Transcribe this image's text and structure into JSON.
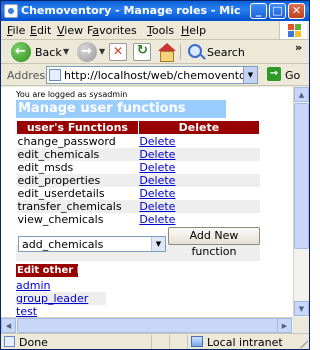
{
  "window": {
    "title": "Chemoventory - Manage roles - Microsoft Internet Ex...",
    "minimize": "_",
    "maximize": "□",
    "close": "✕"
  },
  "menu": {
    "items": [
      {
        "pre": "",
        "key": "F",
        "post": "ile"
      },
      {
        "pre": "",
        "key": "E",
        "post": "dit"
      },
      {
        "pre": "",
        "key": "V",
        "post": "iew"
      },
      {
        "pre": "F",
        "key": "a",
        "post": "vorites"
      },
      {
        "pre": "",
        "key": "T",
        "post": "ools"
      },
      {
        "pre": "",
        "key": "H",
        "post": "elp"
      }
    ]
  },
  "toolbar": {
    "back": "Back",
    "search": "Search",
    "overflow": "»"
  },
  "address": {
    "label": "Address",
    "url": "http://localhost/web/chemoventory/manage_fun",
    "go": "Go"
  },
  "page": {
    "logged_in": "You are logged as sysadmin",
    "title": "Manage user functions",
    "table": {
      "col_functions": "user's Functions",
      "col_delete": "Delete",
      "rows": [
        {
          "name": "change_password",
          "action": "Delete"
        },
        {
          "name": "edit_chemicals",
          "action": "Delete"
        },
        {
          "name": "edit_msds",
          "action": "Delete"
        },
        {
          "name": "edit_properties",
          "action": "Delete"
        },
        {
          "name": "edit_userdetails",
          "action": "Delete"
        },
        {
          "name": "transfer_chemicals",
          "action": "Delete"
        },
        {
          "name": "view_chemicals",
          "action": "Delete"
        }
      ]
    },
    "select_value": "add_chemicals",
    "add_button": "Add New function",
    "roles_title": "Edit other Roles",
    "roles": [
      "admin",
      "group_leader",
      "test"
    ]
  },
  "status": {
    "text": "Done",
    "zone": "Local intranet"
  }
}
